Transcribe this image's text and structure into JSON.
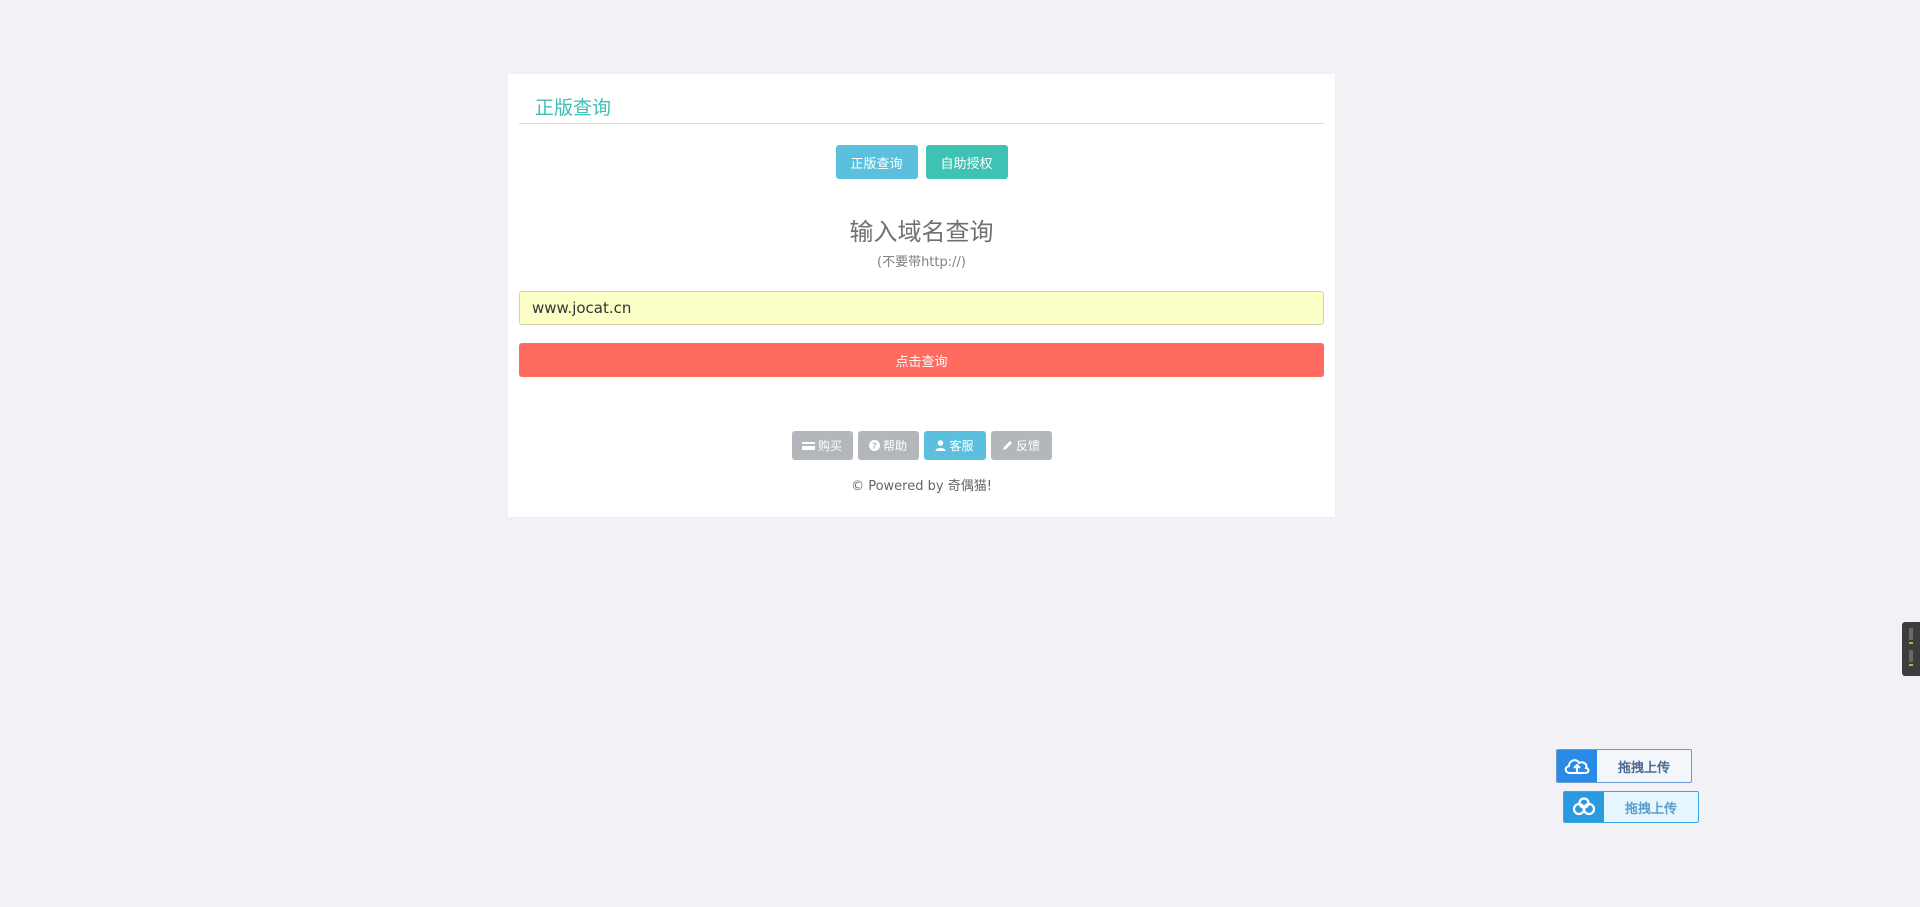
{
  "panel": {
    "title": "正版查询",
    "tabs": [
      {
        "label": "正版查询"
      },
      {
        "label": "自助授权"
      }
    ],
    "heading": "输入域名查询",
    "subheading": "(不要带http://)",
    "domain_input": {
      "value": "www.jocat.cn",
      "placeholder": ""
    },
    "submit_label": "点击查询",
    "footer_buttons": [
      {
        "label": "购买",
        "icon": "card-icon"
      },
      {
        "label": "帮助",
        "icon": "help-icon"
      },
      {
        "label": "客服",
        "icon": "user-icon"
      },
      {
        "label": "反馈",
        "icon": "pencil-icon"
      }
    ],
    "copyright": "© Powered by 奇偶猫!"
  },
  "upload_widgets": [
    {
      "label": "拖拽上传",
      "icon": "cloud-upload-icon"
    },
    {
      "label": "拖拽上传",
      "icon": "baidu-cloud-icon"
    }
  ],
  "colors": {
    "background": "#f2f2f6",
    "title_teal": "#3dbeb4",
    "tab_query": "#5bc0de",
    "tab_auth": "#3dc2b4",
    "input_bg": "#fbffc6",
    "submit": "#ff6b5e",
    "mini_btn": "#b3b6bb",
    "mini_btn_active": "#5bc0de"
  }
}
